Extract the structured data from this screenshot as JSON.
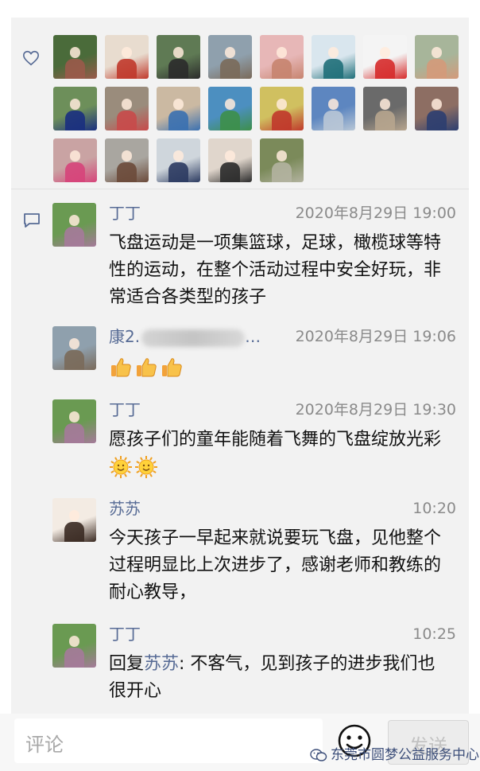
{
  "likes": {
    "icon": "heart-outline-icon",
    "avatars": [
      {
        "name": "liker-avatar",
        "c1": "#4a6b3a",
        "c2": "#9a5a4a"
      },
      {
        "name": "liker-avatar",
        "c1": "#e8dccf",
        "c2": "#c0392b"
      },
      {
        "name": "liker-avatar",
        "c1": "#5f7a54",
        "c2": "#2b2b2b"
      },
      {
        "name": "liker-avatar",
        "c1": "#8fa0ad",
        "c2": "#7a6a5a"
      },
      {
        "name": "liker-avatar",
        "c1": "#e7b7b7",
        "c2": "#c7846f"
      },
      {
        "name": "liker-avatar",
        "c1": "#d9e6ee",
        "c2": "#1f6f79"
      },
      {
        "name": "liker-avatar",
        "c1": "#f4f4f4",
        "c2": "#d62b2b"
      },
      {
        "name": "liker-avatar",
        "c1": "#a7b59a",
        "c2": "#d49a7a"
      },
      {
        "name": "liker-avatar",
        "c1": "#6d8f5a",
        "c2": "#1a2f80"
      },
      {
        "name": "liker-avatar",
        "c1": "#9a8c7c",
        "c2": "#c84a4a"
      },
      {
        "name": "liker-avatar",
        "c1": "#cbb9a2",
        "c2": "#3a70b0"
      },
      {
        "name": "liker-avatar",
        "c1": "#4c8fc0",
        "c2": "#3d8f4a"
      },
      {
        "name": "liker-avatar",
        "c1": "#d0c060",
        "c2": "#c0392b"
      },
      {
        "name": "liker-avatar",
        "c1": "#5d86c0",
        "c2": "#b9c7d6"
      },
      {
        "name": "liker-avatar",
        "c1": "#6a6a6a",
        "c2": "#b7a58e"
      },
      {
        "name": "liker-avatar",
        "c1": "#8d6e63",
        "c2": "#2c3e70"
      },
      {
        "name": "liker-avatar",
        "c1": "#c9a3a3",
        "c2": "#d6447a"
      },
      {
        "name": "liker-avatar",
        "c1": "#a9a6a0",
        "c2": "#6b4a3a"
      },
      {
        "name": "liker-avatar",
        "c1": "#cfd6dc",
        "c2": "#2b3a60"
      },
      {
        "name": "liker-avatar",
        "c1": "#e0d6cc",
        "c2": "#2b2b2b"
      },
      {
        "name": "liker-avatar",
        "c1": "#7b8a5a",
        "c2": "#b3b3a0"
      }
    ]
  },
  "comments_icon": "comment-bubble-icon",
  "comments": [
    {
      "name": "丁丁",
      "time": "2020年8月29日 19:00",
      "text": "飞盘运动是一项集篮球，足球，橄榄球等特性的运动，在整个活动过程中安全好玩，非常适合各类型的孩子",
      "avatar": {
        "c1": "#6a9a52",
        "c2": "#a57a9a"
      }
    },
    {
      "name": "康2.",
      "name_suffix": "…",
      "time": "2020年8月29日 19:06",
      "text": "",
      "emoji_icons": [
        "thumbs-up-icon",
        "thumbs-up-icon",
        "thumbs-up-icon"
      ],
      "avatar": {
        "c1": "#8fa0ad",
        "c2": "#7a6a5a"
      }
    },
    {
      "name": "丁丁",
      "time": "2020年8月29日 19:30",
      "text": "愿孩子们的童年能随着飞舞的飞盘绽放光彩",
      "emoji_icons": [
        "sun-face-icon",
        "sun-face-icon"
      ],
      "avatar": {
        "c1": "#6a9a52",
        "c2": "#a57a9a"
      }
    },
    {
      "name": "苏苏",
      "time": "10:20",
      "text": "今天孩子一早起来就说要玩飞盘，见他整个过程明显比上次进步了，感谢老师和教练的耐心教导，",
      "avatar": {
        "c1": "#f3ebe3",
        "c2": "#3a2a22"
      }
    },
    {
      "name": "丁丁",
      "time": "10:25",
      "reply_prefix": "回复",
      "reply_to": "苏苏",
      "text": ": 不客气，见到孩子的进步我们也很开心",
      "avatar": {
        "c1": "#6a9a52",
        "c2": "#a57a9a"
      }
    }
  ],
  "input_bar": {
    "placeholder": "评论",
    "emoji_icon": "smiley-face-icon",
    "send_label": "发送",
    "watermark": "东莞市圆梦公益服务中心",
    "watermark_icon": "wechat-logo-icon"
  },
  "colors": {
    "link": "#576b95",
    "time": "#8a8a8a",
    "panel": "#f2f2f2"
  }
}
